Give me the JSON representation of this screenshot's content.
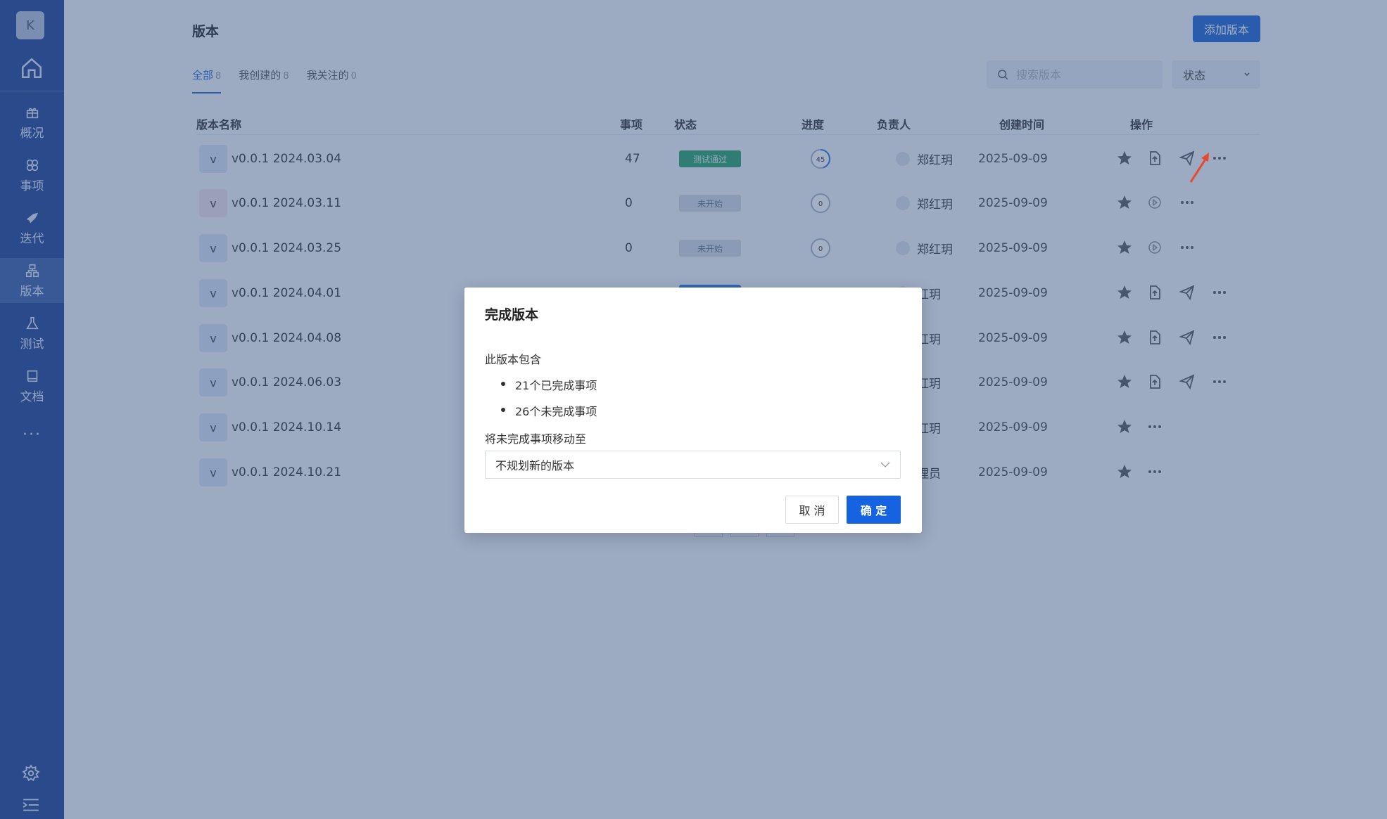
{
  "sidebar": {
    "avatar_letter": "K",
    "items": [
      {
        "label": "概况",
        "icon": "gift-icon"
      },
      {
        "label": "事项",
        "icon": "issue-icon"
      },
      {
        "label": "迭代",
        "icon": "sprint-icon"
      },
      {
        "label": "版本",
        "icon": "version-icon",
        "active": true
      },
      {
        "label": "测试",
        "icon": "flask-icon"
      },
      {
        "label": "文档",
        "icon": "book-icon"
      }
    ],
    "more": "···"
  },
  "header": {
    "title": "版本",
    "add_button": "添加版本"
  },
  "tabs": [
    {
      "label": "全部",
      "count": "8",
      "active": true
    },
    {
      "label": "我创建的",
      "count": "8"
    },
    {
      "label": "我关注的",
      "count": "0"
    }
  ],
  "search": {
    "placeholder": "搜索版本"
  },
  "status_filter": {
    "label": "状态"
  },
  "table": {
    "columns": [
      "版本名称",
      "事项",
      "状态",
      "进度",
      "负责人",
      "创建时间",
      "操作"
    ],
    "rows": [
      {
        "icon": "v",
        "name": "v0.0.1 2024.03.04",
        "count": "47",
        "status": "测试通过",
        "status_kind": "pass",
        "progress": "45",
        "progress_value": 0.45,
        "owner": "郑红玥",
        "date": "2025-09-09",
        "actions": [
          "star",
          "upload",
          "send",
          "more"
        ]
      },
      {
        "icon": "v",
        "name": "v0.0.1 2024.03.11",
        "count": "0",
        "status": "未开始",
        "status_kind": "todo",
        "progress": "0",
        "progress_value": 0,
        "owner": "郑红玥",
        "date": "2025-09-09",
        "actions": [
          "star",
          "play",
          "more"
        ]
      },
      {
        "icon": "v",
        "name": "v0.0.1 2024.03.25",
        "count": "0",
        "status": "未开始",
        "status_kind": "todo",
        "progress": "0",
        "progress_value": 0,
        "owner": "郑红玥",
        "date": "2025-09-09",
        "actions": [
          "star",
          "play",
          "more"
        ]
      },
      {
        "icon": "v",
        "name": "v0.0.1 2024.04.01",
        "count": "",
        "status": "",
        "status_kind": "doing",
        "progress": "",
        "progress_value": 0,
        "owner": "红玥",
        "date": "2025-09-09",
        "actions": [
          "star",
          "upload",
          "send",
          "more"
        ]
      },
      {
        "icon": "v",
        "name": "v0.0.1 2024.04.08",
        "count": "",
        "status": "",
        "status_kind": "",
        "progress": "",
        "progress_value": 0,
        "owner": "红玥",
        "date": "2025-09-09",
        "actions": [
          "star",
          "upload",
          "send",
          "more"
        ]
      },
      {
        "icon": "v",
        "name": "v0.0.1 2024.06.03",
        "count": "",
        "status": "",
        "status_kind": "",
        "progress": "",
        "progress_value": 0,
        "owner": "红玥",
        "date": "2025-09-09",
        "actions": [
          "star",
          "upload",
          "send",
          "more"
        ]
      },
      {
        "icon": "v",
        "name": "v0.0.1 2024.10.14",
        "count": "",
        "status": "",
        "status_kind": "",
        "progress": "",
        "progress_value": 0,
        "owner": "红玥",
        "date": "2025-09-09",
        "actions": [
          "star",
          "more"
        ]
      },
      {
        "icon": "v",
        "name": "v0.0.1 2024.10.21",
        "count": "",
        "status": "",
        "status_kind": "",
        "progress": "",
        "progress_value": 0,
        "owner": "理员",
        "date": "2025-09-09",
        "actions": [
          "star",
          "more"
        ]
      }
    ]
  },
  "modal": {
    "title": "完成版本",
    "contains_label": "此版本包含",
    "items": [
      "21个已完成事项",
      "26个未完成事项"
    ],
    "move_label": "将未完成事项移动至",
    "select_value": "不规划新的版本",
    "cancel": "取 消",
    "confirm": "确 定"
  },
  "colors": {
    "sidebar": "#1d4196",
    "primary": "#1e63d6",
    "status_pass": "#26a06a",
    "status_todo": "#d4d9e4",
    "annotation_arrow": "#e8492e"
  }
}
